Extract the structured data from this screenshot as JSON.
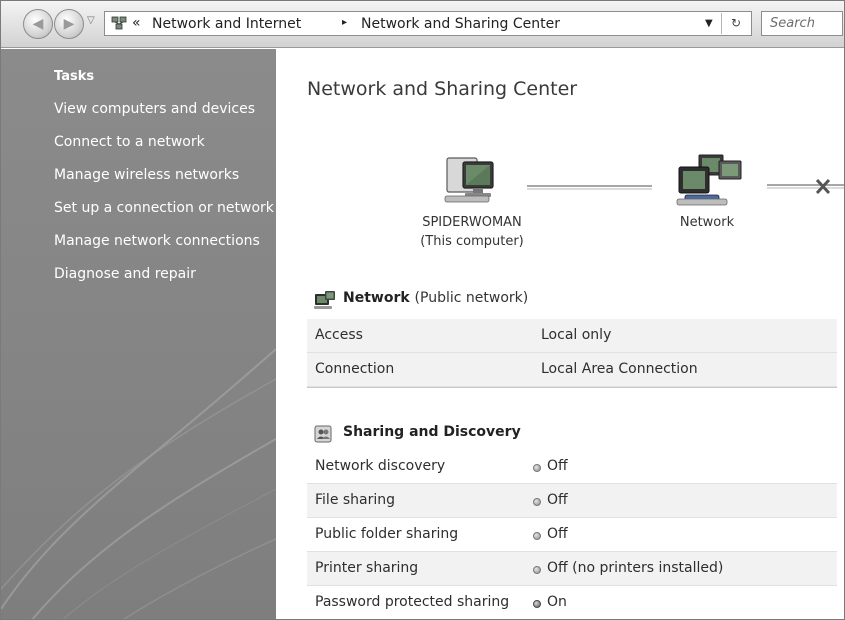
{
  "address_bar": {
    "crumb_more": "«",
    "crumbs": [
      "Network and Internet",
      "Network and Sharing Center"
    ],
    "separator": "▸",
    "search_placeholder": "Search",
    "back_icon": "back-arrow-icon",
    "forward_icon": "forward-arrow-icon",
    "refresh_icon": "refresh-icon"
  },
  "sidebar": {
    "title": "Tasks",
    "items": [
      "View computers and devices",
      "Connect to a network",
      "Manage wireless networks",
      "Set up a connection or network",
      "Manage network connections",
      "Diagnose and repair"
    ]
  },
  "main": {
    "title": "Network and Sharing Center",
    "map": {
      "computer_name": "SPIDERWOMAN",
      "computer_sub": "(This computer)",
      "network_label": "Network",
      "internet_status": "disconnected"
    },
    "network_section": {
      "name": "Network",
      "type": "(Public network)",
      "rows": [
        {
          "label": "Access",
          "value": "Local only"
        },
        {
          "label": "Connection",
          "value": "Local Area Connection"
        }
      ]
    },
    "sharing_section": {
      "title": "Sharing and Discovery",
      "rows": [
        {
          "label": "Network discovery",
          "status": "Off",
          "on": false
        },
        {
          "label": "File sharing",
          "status": "Off",
          "on": false
        },
        {
          "label": "Public folder sharing",
          "status": "Off",
          "on": false
        },
        {
          "label": "Printer sharing",
          "status": "Off (no printers installed)",
          "on": false
        },
        {
          "label": "Password protected sharing",
          "status": "On",
          "on": true
        }
      ]
    }
  }
}
